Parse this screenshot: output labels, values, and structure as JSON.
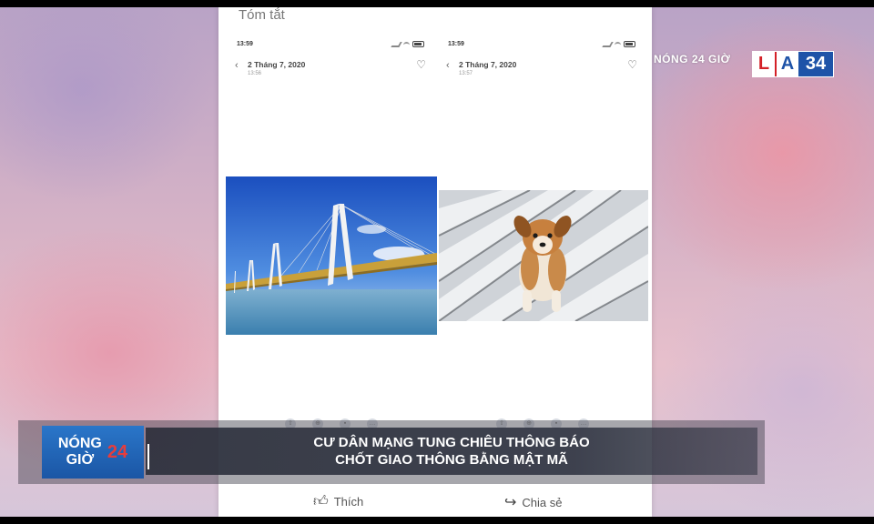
{
  "phone": {
    "header_text": "Tóm tắt",
    "screens": [
      {
        "status_time": "13:59",
        "date": "2 Tháng 7, 2020",
        "time": "13:56"
      },
      {
        "status_time": "13:59",
        "date": "2 Tháng 7, 2020",
        "time": "13:57"
      }
    ],
    "actions": {
      "like": "Thích",
      "share": "Chia sẻ"
    }
  },
  "channel": {
    "program_tag": "NÓNG 24 GIỜ",
    "logo": {
      "l": "L",
      "a": "A",
      "number": "34"
    }
  },
  "ticker": {
    "badge_line1": "NÓNG",
    "badge_line2": "GIỜ",
    "badge_number": "24",
    "headline_line1": "CƯ DÂN MẠNG TUNG CHIÊU THÔNG BÁO",
    "headline_line2": "CHỐT GIAO THÔNG BẰNG MẬT MÃ"
  },
  "colors": {
    "logo_red": "#d42027",
    "logo_blue": "#1e53a8",
    "ticker_badge": "#1b56a5"
  },
  "icons": [
    "back-chevron-icon",
    "heart-icon",
    "thumbs-up-icon",
    "share-icon",
    "signal-icon",
    "wifi-icon",
    "battery-icon"
  ]
}
